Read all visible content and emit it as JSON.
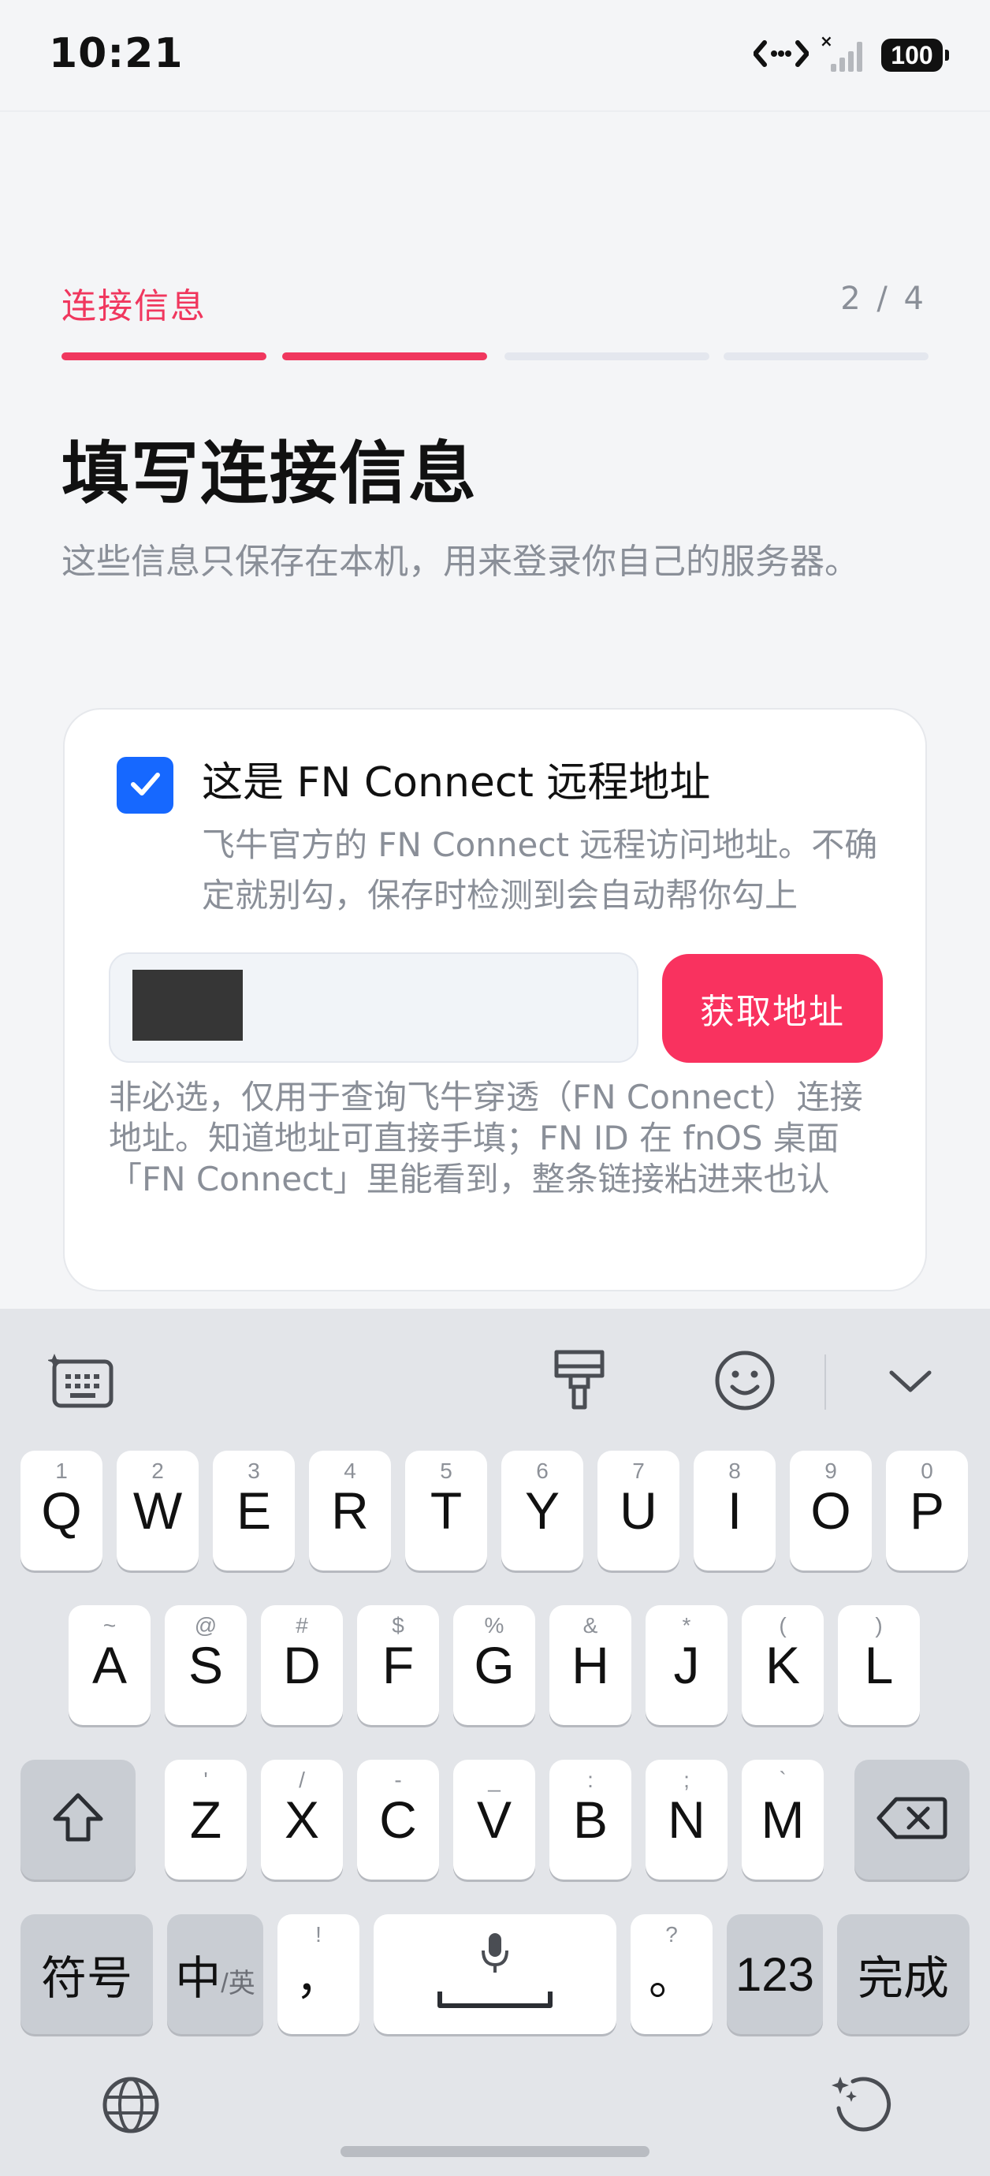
{
  "status_bar": {
    "time": "10:21",
    "battery": "100",
    "icons": [
      "data-transfer-icon",
      "signal-icon",
      "battery-icon"
    ]
  },
  "step": {
    "label": "连接信息",
    "counter": "2 / 4",
    "current": 2,
    "total": 4
  },
  "page": {
    "title": "填写连接信息",
    "subtitle": "这些信息只保存在本机，用来登录你自己的服务器。"
  },
  "card": {
    "checkbox_checked": true,
    "option_title": "这是 FN Connect 远程地址",
    "option_desc": "飞牛官方的 FN Connect 远程访问地址。不确定就别勾，保存时检测到会自动帮你勾上",
    "fetch_button": "获取地址",
    "hint": "非必选，仅用于查询飞牛穿透（FN Connect）连接地址。知道地址可直接手填；FN ID 在 fnOS 桌面「FN Connect」里能看到，整条链接粘进来也认"
  },
  "keyboard": {
    "row1": [
      {
        "k": "Q",
        "s": "1"
      },
      {
        "k": "W",
        "s": "2"
      },
      {
        "k": "E",
        "s": "3"
      },
      {
        "k": "R",
        "s": "4"
      },
      {
        "k": "T",
        "s": "5"
      },
      {
        "k": "Y",
        "s": "6"
      },
      {
        "k": "U",
        "s": "7"
      },
      {
        "k": "I",
        "s": "8"
      },
      {
        "k": "O",
        "s": "9"
      },
      {
        "k": "P",
        "s": "0"
      }
    ],
    "row2": [
      {
        "k": "A",
        "s": "~"
      },
      {
        "k": "S",
        "s": "@"
      },
      {
        "k": "D",
        "s": "#"
      },
      {
        "k": "F",
        "s": "$"
      },
      {
        "k": "G",
        "s": "%"
      },
      {
        "k": "H",
        "s": "&"
      },
      {
        "k": "J",
        "s": "*"
      },
      {
        "k": "K",
        "s": "("
      },
      {
        "k": "L",
        "s": ")"
      }
    ],
    "row3": [
      {
        "k": "Z",
        "s": "'"
      },
      {
        "k": "X",
        "s": "/"
      },
      {
        "k": "C",
        "s": "-"
      },
      {
        "k": "V",
        "s": "_"
      },
      {
        "k": "B",
        "s": ":"
      },
      {
        "k": "N",
        "s": ";"
      },
      {
        "k": "M",
        "s": "`"
      }
    ],
    "symbols_key": "符号",
    "lang_key_main": "中",
    "lang_key_sub": "/英",
    "comma_key": "，",
    "comma_sub": "!",
    "period_key": "。",
    "period_sub": "?",
    "num_key": "123",
    "done_key": "完成"
  }
}
